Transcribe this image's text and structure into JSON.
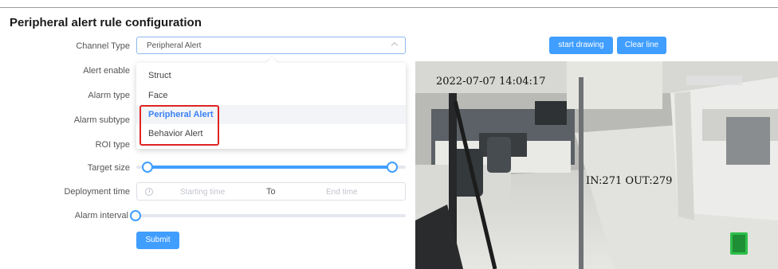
{
  "page": {
    "title": "Peripheral alert rule configuration"
  },
  "form": {
    "channel_type": {
      "label": "Channel Type",
      "value": "Peripheral Alert"
    },
    "alert_enable": {
      "label": "Alert enable"
    },
    "alarm_type": {
      "label": "Alarm type"
    },
    "alarm_subtype": {
      "label": "Alarm subtype"
    },
    "roi_type": {
      "label": "ROI type"
    },
    "target_size": {
      "label": "Target size",
      "min_fraction": 0.04,
      "max_fraction": 0.95
    },
    "deployment_time": {
      "label": "Deployment time",
      "start_placeholder": "Starting time",
      "separator": "To",
      "end_placeholder": "End time"
    },
    "alarm_interval": {
      "label": "Alarm interval",
      "value_fraction": 0.0
    },
    "submit_label": "Submit"
  },
  "dropdown": {
    "options": [
      "Struct",
      "Face",
      "Peripheral Alert",
      "Behavior Alert"
    ],
    "selected": "Peripheral Alert"
  },
  "toolbar": {
    "start_drawing_label": "start drawing",
    "clear_line_label": "Clear line"
  },
  "video": {
    "timestamp": "2022-07-07 14:04:17",
    "counter": "IN:271 OUT:279"
  },
  "colors": {
    "accent": "#409eff",
    "highlight_border": "#e02424"
  }
}
